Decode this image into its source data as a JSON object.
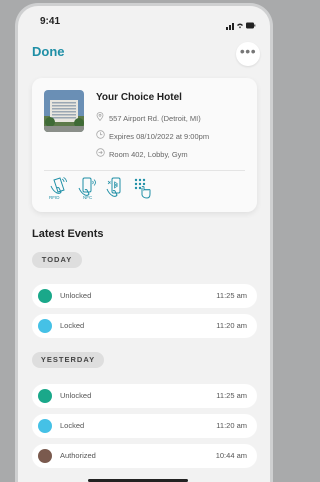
{
  "status": {
    "time": "9:41"
  },
  "header": {
    "done_label": "Done",
    "more_label": "•••"
  },
  "hotel": {
    "name": "Your Choice Hotel",
    "address": "557 Airport Rd. (Detroit, MI)",
    "expires": "Expires 08/10/2022 at 9:00pm",
    "rooms": "Room 402, Lobby, Gym",
    "access_methods": [
      {
        "label": "RFID",
        "icon": "rfid-icon"
      },
      {
        "label": "NFC",
        "icon": "nfc-phone-icon"
      },
      {
        "label": "",
        "icon": "bluetooth-phone-icon"
      },
      {
        "label": "",
        "icon": "keypad-icon"
      }
    ]
  },
  "events": {
    "title": "Latest Events",
    "groups": [
      {
        "label": "TODAY",
        "items": [
          {
            "label": "Unlocked",
            "time": "11:25 am",
            "color": "#1aa88a"
          },
          {
            "label": "Locked",
            "time": "11:20 am",
            "color": "#45c1e6"
          }
        ]
      },
      {
        "label": "YESTERDAY",
        "items": [
          {
            "label": "Unlocked",
            "time": "11:25 am",
            "color": "#1aa88a"
          },
          {
            "label": "Locked",
            "time": "11:20 am",
            "color": "#45c1e6"
          },
          {
            "label": "Authorized",
            "time": "10:44 am",
            "color": "#7a5a4e"
          }
        ]
      }
    ]
  }
}
